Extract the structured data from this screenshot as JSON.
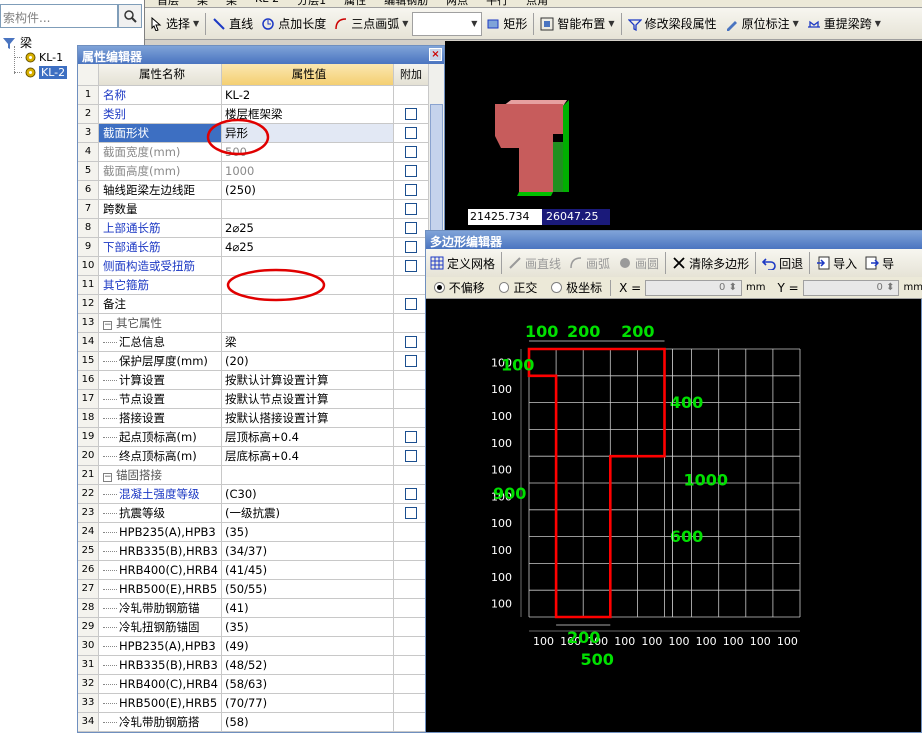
{
  "tree": {
    "search_placeholder": "索构件...",
    "root_label": "梁",
    "items": [
      "KL-1",
      "KL-2"
    ]
  },
  "top_toolbar": {
    "row1_partial": [
      "首层",
      "梁",
      "梁",
      "KL-2",
      "分层1",
      "属性",
      "编辑钢筋",
      "两点",
      "平行",
      "点角"
    ],
    "items": [
      {
        "label": "选择",
        "icon": "pointer-icon"
      },
      {
        "label": "直线",
        "icon": "line-icon"
      },
      {
        "label": "点加长度",
        "icon": "point-length-icon"
      },
      {
        "label": "三点画弧",
        "icon": "arc-icon"
      },
      {
        "label": "矩形",
        "icon": "rectangle-icon"
      },
      {
        "label": "智能布置",
        "icon": "smart-layout-icon"
      },
      {
        "label": "修改梁段属性",
        "icon": "edit-beam-icon"
      },
      {
        "label": "原位标注",
        "icon": "annotation-icon"
      },
      {
        "label": "重提梁跨",
        "icon": "beam-span-icon"
      }
    ]
  },
  "attr_editor": {
    "title": "属性编辑器",
    "headers": {
      "name": "属性名称",
      "value": "属性值",
      "extra": "附加"
    },
    "rows": [
      {
        "no": "1",
        "name": "名称",
        "value": "KL-2",
        "style": "blue",
        "check": false
      },
      {
        "no": "2",
        "name": "类别",
        "value": "楼层框架梁",
        "style": "blue",
        "check": true
      },
      {
        "no": "3",
        "name": "截面形状",
        "value": "异形",
        "style": "sel",
        "check": true
      },
      {
        "no": "4",
        "name": "截面宽度(mm)",
        "value": "500",
        "style": "grey",
        "check": true
      },
      {
        "no": "5",
        "name": "截面高度(mm)",
        "value": "1000",
        "style": "grey",
        "check": true
      },
      {
        "no": "6",
        "name": "轴线距梁左边线距",
        "value": "(250)",
        "style": "",
        "check": true
      },
      {
        "no": "7",
        "name": "跨数量",
        "value": "",
        "style": "",
        "check": true
      },
      {
        "no": "8",
        "name": "上部通长筋",
        "value": "2⌀25",
        "style": "blue",
        "check": true
      },
      {
        "no": "9",
        "name": "下部通长筋",
        "value": "4⌀25",
        "style": "blue",
        "check": true
      },
      {
        "no": "10",
        "name": "侧面构造或受扭筋",
        "value": "",
        "style": "blue",
        "check": true
      },
      {
        "no": "11",
        "name": "其它箍筋",
        "value": "",
        "style": "blue",
        "check": false
      },
      {
        "no": "12",
        "name": "备注",
        "value": "",
        "style": "",
        "check": true
      },
      {
        "no": "13",
        "name": "其它属性",
        "value": "",
        "style": "group",
        "check": false
      },
      {
        "no": "14",
        "name": "汇总信息",
        "value": "梁",
        "style": "indent",
        "check": true
      },
      {
        "no": "15",
        "name": "保护层厚度(mm)",
        "value": "(20)",
        "style": "indent",
        "check": true
      },
      {
        "no": "16",
        "name": "计算设置",
        "value": "按默认计算设置计算",
        "style": "indent",
        "check": false
      },
      {
        "no": "17",
        "name": "节点设置",
        "value": "按默认节点设置计算",
        "style": "indent",
        "check": false
      },
      {
        "no": "18",
        "name": "搭接设置",
        "value": "按默认搭接设置计算",
        "style": "indent",
        "check": false
      },
      {
        "no": "19",
        "name": "起点顶标高(m)",
        "value": "层顶标高+0.4",
        "style": "indent",
        "check": true
      },
      {
        "no": "20",
        "name": "终点顶标高(m)",
        "value": "层底标高+0.4",
        "style": "indent",
        "check": true
      },
      {
        "no": "21",
        "name": "锚固搭接",
        "value": "",
        "style": "group",
        "check": false
      },
      {
        "no": "22",
        "name": "混凝土强度等级",
        "value": "(C30)",
        "style": "indent blue",
        "check": true
      },
      {
        "no": "23",
        "name": "抗震等级",
        "value": "(一级抗震)",
        "style": "indent",
        "check": true
      },
      {
        "no": "24",
        "name": "HPB235(A),HPB3",
        "value": "(35)",
        "style": "indent",
        "check": false
      },
      {
        "no": "25",
        "name": "HRB335(B),HRB3",
        "value": "(34/37)",
        "style": "indent",
        "check": false
      },
      {
        "no": "26",
        "name": "HRB400(C),HRB4",
        "value": "(41/45)",
        "style": "indent",
        "check": false
      },
      {
        "no": "27",
        "name": "HRB500(E),HRB5",
        "value": "(50/55)",
        "style": "indent",
        "check": false
      },
      {
        "no": "28",
        "name": "冷轧带肋钢筋锚",
        "value": "(41)",
        "style": "indent",
        "check": false
      },
      {
        "no": "29",
        "name": "冷轧扭钢筋锚固",
        "value": "(35)",
        "style": "indent",
        "check": false
      },
      {
        "no": "30",
        "name": "HPB235(A),HPB3",
        "value": "(49)",
        "style": "indent",
        "check": false
      },
      {
        "no": "31",
        "name": "HRB335(B),HRB3",
        "value": "(48/52)",
        "style": "indent",
        "check": false
      },
      {
        "no": "32",
        "name": "HRB400(C),HRB4",
        "value": "(58/63)",
        "style": "indent",
        "check": false
      },
      {
        "no": "33",
        "name": "HRB500(E),HRB5",
        "value": "(70/77)",
        "style": "indent",
        "check": false
      },
      {
        "no": "34",
        "name": "冷轧带肋钢筋搭",
        "value": "(58)",
        "style": "indent",
        "check": false
      }
    ]
  },
  "coords": {
    "x": "21425.734",
    "y": "26047.25"
  },
  "poly_editor": {
    "title": "多边形编辑器",
    "toolbar": [
      {
        "label": "定义网格",
        "icon": "grid-icon",
        "enabled": true
      },
      {
        "label": "画直线",
        "icon": "line-icon",
        "enabled": false
      },
      {
        "label": "画弧",
        "icon": "arc-icon",
        "enabled": false
      },
      {
        "label": "画圆",
        "icon": "circle-icon",
        "enabled": false
      },
      {
        "label": "清除多边形",
        "icon": "clear-icon",
        "enabled": true
      },
      {
        "label": "回退",
        "icon": "undo-icon",
        "enabled": true
      },
      {
        "label": "导入",
        "icon": "import-icon",
        "enabled": true
      },
      {
        "label": "导",
        "icon": "export-icon",
        "enabled": true
      }
    ],
    "options": {
      "modes": [
        {
          "label": "不偏移",
          "on": true
        },
        {
          "label": "正交",
          "on": false
        },
        {
          "label": "极坐标",
          "on": false
        }
      ],
      "x_label": "X =",
      "x_value": "0",
      "y_label": "Y =",
      "y_value": "0",
      "unit": "mm"
    },
    "grid": {
      "cols": 10,
      "rows": 10,
      "col_label": "100",
      "row_label": "100"
    },
    "dims": {
      "top": [
        "100",
        "200",
        "200"
      ],
      "right_inner": [
        "400",
        "600"
      ],
      "right_total": "1000",
      "left_total": "900",
      "left_first": "100",
      "bottom_web": "200",
      "bottom_total": "500"
    }
  },
  "colors": {
    "polygon": "#ff0000",
    "dimension": "#00e000",
    "annotation": "#e00000"
  }
}
